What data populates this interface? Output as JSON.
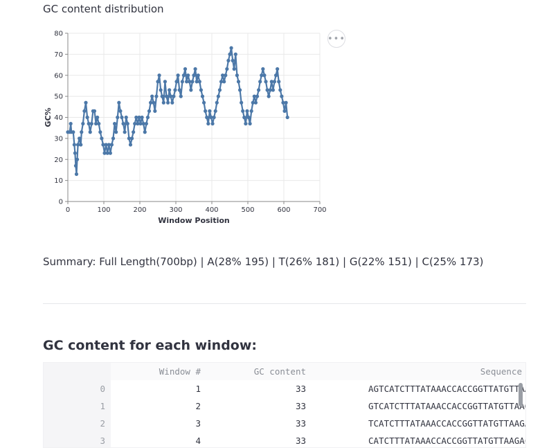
{
  "page": {
    "chart_caption": "GC content distribution",
    "summary": "Summary: Full Length(700bp) | A(28% 195) | T(26% 181) | G(22% 151) | C(25% 173)",
    "table_heading": "GC content for each window:",
    "menu_icon": "ellipsis-icon"
  },
  "table": {
    "columns": [
      "",
      "Window #",
      "GC content",
      "Sequence"
    ],
    "rows": [
      {
        "index": "0",
        "window": "1",
        "gc": "33",
        "seq": "AGTCATCTTTATAAACCACCGGTTATGTTAAGAC"
      },
      {
        "index": "1",
        "window": "2",
        "gc": "33",
        "seq": "GTCATCTTTATAAACCACCGGTTATGTTAAGACC"
      },
      {
        "index": "2",
        "window": "3",
        "gc": "33",
        "seq": "TCATCTTTATAAACCACCGGTTATGTTAAGACCA"
      },
      {
        "index": "3",
        "window": "4",
        "gc": "33",
        "seq": "CATCTTTATAAACCACCGGTTATGTTAAGACCAG"
      }
    ]
  },
  "chart_data": {
    "type": "line",
    "xlabel": "Window Position",
    "ylabel": "GC%",
    "xlim": [
      0,
      700
    ],
    "ylim": [
      0,
      80
    ],
    "xticks": [
      0,
      100,
      200,
      300,
      400,
      500,
      600,
      700
    ],
    "yticks": [
      0,
      10,
      20,
      30,
      40,
      50,
      60,
      70,
      80
    ],
    "color": "#4c78a8",
    "points": [
      [
        0,
        33
      ],
      [
        5,
        33
      ],
      [
        8,
        37
      ],
      [
        10,
        33
      ],
      [
        15,
        33
      ],
      [
        18,
        27
      ],
      [
        20,
        23
      ],
      [
        22,
        17
      ],
      [
        24,
        13
      ],
      [
        26,
        20
      ],
      [
        28,
        27
      ],
      [
        32,
        30
      ],
      [
        36,
        27
      ],
      [
        38,
        33
      ],
      [
        42,
        37
      ],
      [
        46,
        43
      ],
      [
        50,
        47
      ],
      [
        54,
        40
      ],
      [
        58,
        37
      ],
      [
        62,
        33
      ],
      [
        66,
        37
      ],
      [
        70,
        43
      ],
      [
        74,
        43
      ],
      [
        78,
        37
      ],
      [
        82,
        40
      ],
      [
        86,
        37
      ],
      [
        90,
        33
      ],
      [
        94,
        30
      ],
      [
        98,
        27
      ],
      [
        102,
        23
      ],
      [
        106,
        27
      ],
      [
        110,
        23
      ],
      [
        114,
        27
      ],
      [
        118,
        23
      ],
      [
        122,
        27
      ],
      [
        126,
        30
      ],
      [
        130,
        37
      ],
      [
        134,
        33
      ],
      [
        138,
        40
      ],
      [
        142,
        47
      ],
      [
        146,
        43
      ],
      [
        150,
        40
      ],
      [
        154,
        37
      ],
      [
        158,
        33
      ],
      [
        162,
        40
      ],
      [
        166,
        37
      ],
      [
        170,
        30
      ],
      [
        174,
        27
      ],
      [
        178,
        30
      ],
      [
        182,
        33
      ],
      [
        186,
        37
      ],
      [
        190,
        40
      ],
      [
        194,
        37
      ],
      [
        198,
        40
      ],
      [
        202,
        37
      ],
      [
        206,
        40
      ],
      [
        210,
        37
      ],
      [
        214,
        33
      ],
      [
        218,
        37
      ],
      [
        222,
        40
      ],
      [
        226,
        43
      ],
      [
        230,
        47
      ],
      [
        234,
        50
      ],
      [
        238,
        47
      ],
      [
        242,
        43
      ],
      [
        246,
        50
      ],
      [
        250,
        57
      ],
      [
        254,
        60
      ],
      [
        258,
        53
      ],
      [
        262,
        50
      ],
      [
        266,
        47
      ],
      [
        270,
        57
      ],
      [
        274,
        50
      ],
      [
        278,
        47
      ],
      [
        282,
        53
      ],
      [
        286,
        50
      ],
      [
        290,
        47
      ],
      [
        294,
        50
      ],
      [
        298,
        53
      ],
      [
        302,
        57
      ],
      [
        306,
        60
      ],
      [
        310,
        53
      ],
      [
        314,
        50
      ],
      [
        318,
        57
      ],
      [
        322,
        60
      ],
      [
        326,
        63
      ],
      [
        330,
        57
      ],
      [
        334,
        60
      ],
      [
        338,
        57
      ],
      [
        342,
        53
      ],
      [
        346,
        57
      ],
      [
        350,
        60
      ],
      [
        354,
        63
      ],
      [
        358,
        57
      ],
      [
        362,
        60
      ],
      [
        366,
        57
      ],
      [
        370,
        53
      ],
      [
        374,
        50
      ],
      [
        378,
        47
      ],
      [
        382,
        43
      ],
      [
        386,
        40
      ],
      [
        390,
        37
      ],
      [
        394,
        43
      ],
      [
        398,
        40
      ],
      [
        402,
        37
      ],
      [
        406,
        40
      ],
      [
        410,
        43
      ],
      [
        414,
        47
      ],
      [
        418,
        50
      ],
      [
        422,
        53
      ],
      [
        426,
        57
      ],
      [
        430,
        60
      ],
      [
        434,
        57
      ],
      [
        438,
        60
      ],
      [
        442,
        63
      ],
      [
        446,
        67
      ],
      [
        450,
        70
      ],
      [
        454,
        73
      ],
      [
        458,
        67
      ],
      [
        462,
        63
      ],
      [
        466,
        70
      ],
      [
        470,
        60
      ],
      [
        474,
        57
      ],
      [
        478,
        53
      ],
      [
        482,
        47
      ],
      [
        486,
        43
      ],
      [
        490,
        40
      ],
      [
        494,
        37
      ],
      [
        498,
        43
      ],
      [
        502,
        40
      ],
      [
        506,
        37
      ],
      [
        510,
        43
      ],
      [
        514,
        47
      ],
      [
        518,
        50
      ],
      [
        522,
        47
      ],
      [
        526,
        50
      ],
      [
        530,
        53
      ],
      [
        534,
        57
      ],
      [
        538,
        60
      ],
      [
        542,
        63
      ],
      [
        546,
        60
      ],
      [
        550,
        57
      ],
      [
        554,
        53
      ],
      [
        558,
        50
      ],
      [
        562,
        53
      ],
      [
        566,
        57
      ],
      [
        570,
        53
      ],
      [
        574,
        57
      ],
      [
        578,
        60
      ],
      [
        582,
        63
      ],
      [
        586,
        57
      ],
      [
        590,
        53
      ],
      [
        594,
        50
      ],
      [
        598,
        47
      ],
      [
        602,
        43
      ],
      [
        606,
        47
      ],
      [
        610,
        40
      ]
    ]
  }
}
